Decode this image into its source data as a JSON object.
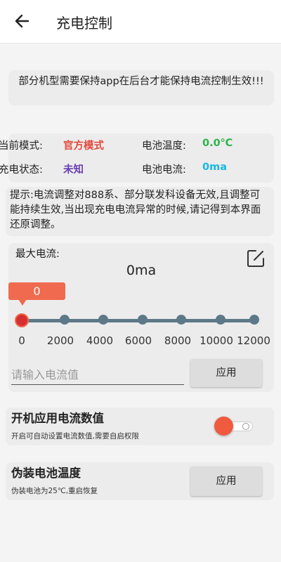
{
  "appbar": {
    "title": "充电控制",
    "back_icon": "arrow-left-icon"
  },
  "notice": {
    "text": "部分机型需要保持app在后台才能保持电流控制生效!!!"
  },
  "status": {
    "mode_label": "当前模式:",
    "mode_value": "官方模式",
    "temp_label": "电池温度:",
    "temp_value": "0.0℃",
    "charge_label": "充电状态:",
    "charge_value": "未知",
    "current_label": "电池电流:",
    "current_value": "0ma",
    "colors": {
      "mode": "#e24b3e",
      "temp": "#2fb24a",
      "charge": "#6b3fb0",
      "current": "#19b7e2"
    }
  },
  "tips": {
    "text": "提示:电流调整对888系、部分联发科设备无效,且调整可能持续生效,当出现充电电流异常的时候,请记得到本界面还原调整。"
  },
  "max_current": {
    "label": "最大电流:",
    "value": "0ma",
    "edit_icon": "edit-icon",
    "slider": {
      "current": "0",
      "ticks": [
        "0",
        "2000",
        "4000",
        "6000",
        "8000",
        "10000",
        "12000"
      ]
    },
    "input_placeholder": "请输入电流值",
    "apply_label": "应用"
  },
  "boot_apply": {
    "title": "开机应用电流数值",
    "subtitle": "开启可自动设置电流数值,需要自启权限",
    "enabled": true
  },
  "fake_temp": {
    "title": "伪装电池温度",
    "subtitle": "伪装电池为25℃,重启恢复",
    "apply_label": "应用"
  },
  "accent": "#ef6a4e"
}
